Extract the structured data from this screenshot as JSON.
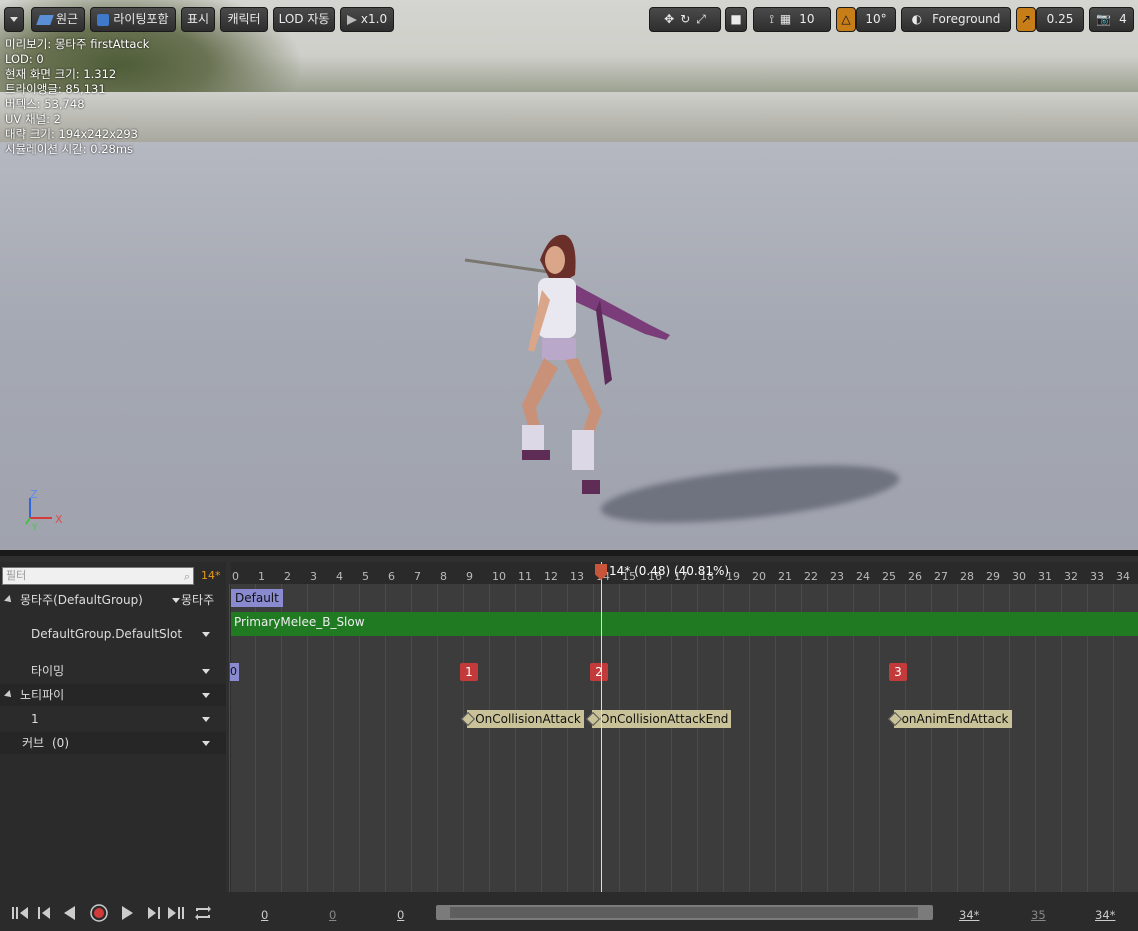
{
  "toolbar": {
    "perspective": "원근",
    "lighting": "라이팅포함",
    "show": "표시",
    "character": "캐릭터",
    "lod": "LOD 자동",
    "speed": "x1.0",
    "grid_size": "10",
    "rotate_snap": "10°",
    "layer": "Foreground",
    "scale_snap": "0.25",
    "camera_speed": "4"
  },
  "stats": [
    "미리보기: 몽타주 firstAttack",
    "LOD: 0",
    "현재 화면 크기: 1.312",
    "트라이앵글: 85,131",
    "버텍스: 53,748",
    "UV 채널: 2",
    "대략 크기: 194x242x293",
    "시뮬레이션 시간: 0.28ms"
  ],
  "axes": {
    "z": "Z",
    "x": "X",
    "y": "Y"
  },
  "timeline": {
    "filter_placeholder": "필터",
    "current_frame": "14*",
    "playhead_label": "14* (0.48) (40.81%)",
    "playhead_frame": 14,
    "ticks": [
      "0",
      "1",
      "2",
      "3",
      "4",
      "5",
      "6",
      "7",
      "8",
      "9",
      "10",
      "11",
      "12",
      "13",
      "14",
      "15",
      "16",
      "17",
      "18",
      "19",
      "20",
      "21",
      "22",
      "23",
      "24",
      "25",
      "26",
      "27",
      "28",
      "29",
      "30",
      "31",
      "32",
      "33",
      "34"
    ],
    "tracks": {
      "montage_group": "몽타주(DefaultGroup)",
      "montage_btn": "몽타주",
      "slot": "DefaultGroup.DefaultSlot",
      "timing": "타이밍",
      "notify": "노티파이",
      "notify_track": "1",
      "curves": "커브",
      "curves_count": "(0)"
    },
    "section_tag": "Default",
    "segment": "PrimaryMelee_B_Slow",
    "timing_start": "0",
    "timing_markers": [
      {
        "label": "1",
        "frame": 9
      },
      {
        "label": "2",
        "frame": 14
      },
      {
        "label": "3",
        "frame": 25.5
      }
    ],
    "notifies": [
      {
        "label": "OnCollisionAttack",
        "frame": 9.2
      },
      {
        "label": "OnCollisionAttackEnd",
        "frame": 14
      },
      {
        "label": "onAnimEndAttack",
        "frame": 25.6
      }
    ]
  },
  "bottom": {
    "n1": "0",
    "n2": "0",
    "n3": "0",
    "n4": "34*",
    "n5": "35",
    "n6": "34*"
  },
  "colors": {
    "accent": "#c77e18",
    "segment": "#1f7a22",
    "marker": "#c23a3a",
    "notify": "#c9c298"
  }
}
